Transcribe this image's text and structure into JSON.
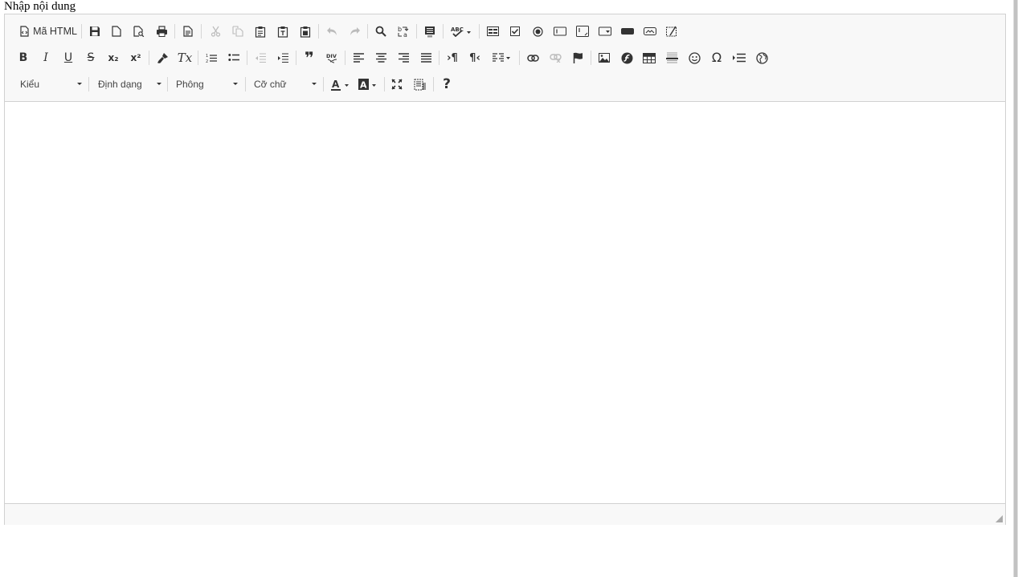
{
  "page": {
    "label": "Nhập nội dung"
  },
  "toolbar": {
    "source_label": "Mã HTML",
    "glyphs": {
      "bold": "B",
      "italic": "I",
      "underline": "U",
      "strike": "S",
      "subscript": "x₂",
      "superscript": "x²",
      "remove_format": "Tx",
      "blockquote": "❞",
      "special_char": "Ω",
      "help": "?",
      "bidi_ltr": "›¶",
      "bidi_rtl": "¶‹"
    },
    "combos": {
      "style": "Kiểu",
      "format": "Định dạng",
      "font": "Phông",
      "size": "Cỡ chữ"
    }
  },
  "colors": {
    "toolbar_bg": "#f8f8f8",
    "border": "#d1d1d1",
    "icon": "#333333",
    "icon_disabled": "#bbbbbb"
  }
}
